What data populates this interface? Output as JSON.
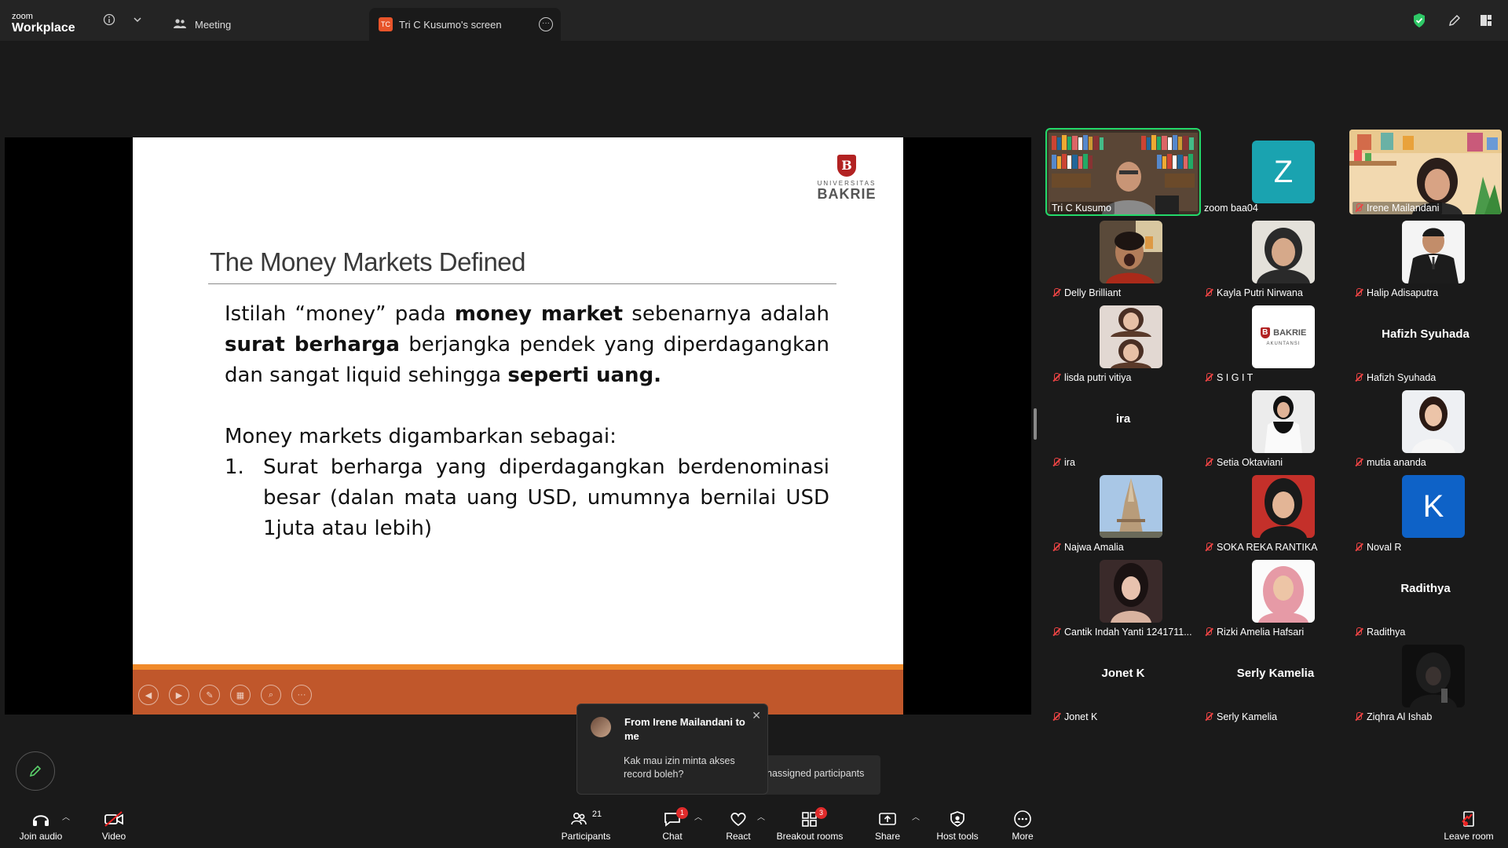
{
  "titlebar": {
    "brand_top": "zoom",
    "brand_bottom": "Workplace",
    "tabs": [
      {
        "label": "Meeting",
        "icon": "people-icon"
      },
      {
        "label": "Tri C Kusumo's screen",
        "badge": "TC"
      }
    ]
  },
  "slide": {
    "logo_upper": "UNIVERSITAS",
    "logo_lower": "BAKRIE",
    "logo_mark": "B",
    "title": "The Money Markets Defined",
    "p1_a": "Istilah “money” pada ",
    "p1_b": "money market",
    "p1_c": " sebenarnya adalah ",
    "p1_d": "surat berharga",
    "p1_e": " berjangka pendek yang diperdagangkan dan sangat liquid sehingga ",
    "p1_f": "seperti  uang.",
    "p2": "Money markets digambarkan sebagai:",
    "item1_num": "1.",
    "item1_text": "Surat berharga yang diperdagangkan berdenominasi besar (dalan mata uang USD, umumnya bernilai USD 1juta atau lebih)"
  },
  "participants": [
    {
      "name": "Tri C Kusumo",
      "type": "video",
      "active": true
    },
    {
      "name": "zoom baa04",
      "type": "letter",
      "letter": "Z",
      "color": "#1aa3b0"
    },
    {
      "name": "Irene Mailandani",
      "type": "video"
    },
    {
      "name": "Delly Brilliant",
      "type": "photo"
    },
    {
      "name": "Kayla Putri Nirwana",
      "type": "photo"
    },
    {
      "name": "Halip Adisaputra",
      "type": "photo"
    },
    {
      "name": "lisda putri vitiya",
      "type": "photo"
    },
    {
      "name": "S I G I T",
      "type": "photo",
      "logo_text": "BAKRIE",
      "logo_sub": "AKUNTANSI"
    },
    {
      "name": "Hafizh Syuhada",
      "type": "name",
      "bigname": "Hafizh Syuhada"
    },
    {
      "name": "ira",
      "type": "name",
      "bigname": "ira"
    },
    {
      "name": "Setia Oktaviani",
      "type": "photo"
    },
    {
      "name": "mutia ananda",
      "type": "photo"
    },
    {
      "name": "Najwa Amalia",
      "type": "photo"
    },
    {
      "name": "SOKA REKA RANTIKA",
      "type": "photo"
    },
    {
      "name": "Noval R",
      "type": "letter",
      "letter": "K",
      "color": "#0e62c7"
    },
    {
      "name": "Cantik Indah Yanti 1241711...",
      "type": "photo"
    },
    {
      "name": "Rizki Amelia Hafsari",
      "type": "photo"
    },
    {
      "name": "Radithya",
      "type": "name",
      "bigname": "Radithya"
    },
    {
      "name": "Jonet K",
      "type": "name",
      "bigname": "Jonet K"
    },
    {
      "name": "Serly Kamelia",
      "type": "name",
      "bigname": "Serly Kamelia"
    },
    {
      "name": "Ziqhra Al Ishab",
      "type": "photo"
    }
  ],
  "chat_popup": {
    "from": "From Irene Mailandani to me",
    "message": "Kak mau izin minta akses record boleh?"
  },
  "tooltip": "nassigned participants",
  "toolbar": {
    "join_audio": "Join audio",
    "video": "Video",
    "participants": "Participants",
    "participants_count": "21",
    "chat": "Chat",
    "chat_badge": "1",
    "react": "React",
    "breakout": "Breakout rooms",
    "breakout_badge": "3",
    "share": "Share",
    "host_tools": "Host tools",
    "more": "More",
    "leave": "Leave room"
  },
  "colors": {
    "active_speaker": "#23d96a",
    "slide_bar": "#c0572b",
    "slide_bar_accent": "#f08a2a",
    "muted": "#e44444",
    "badge": "#e02b2b",
    "shield": "#2ec866"
  }
}
